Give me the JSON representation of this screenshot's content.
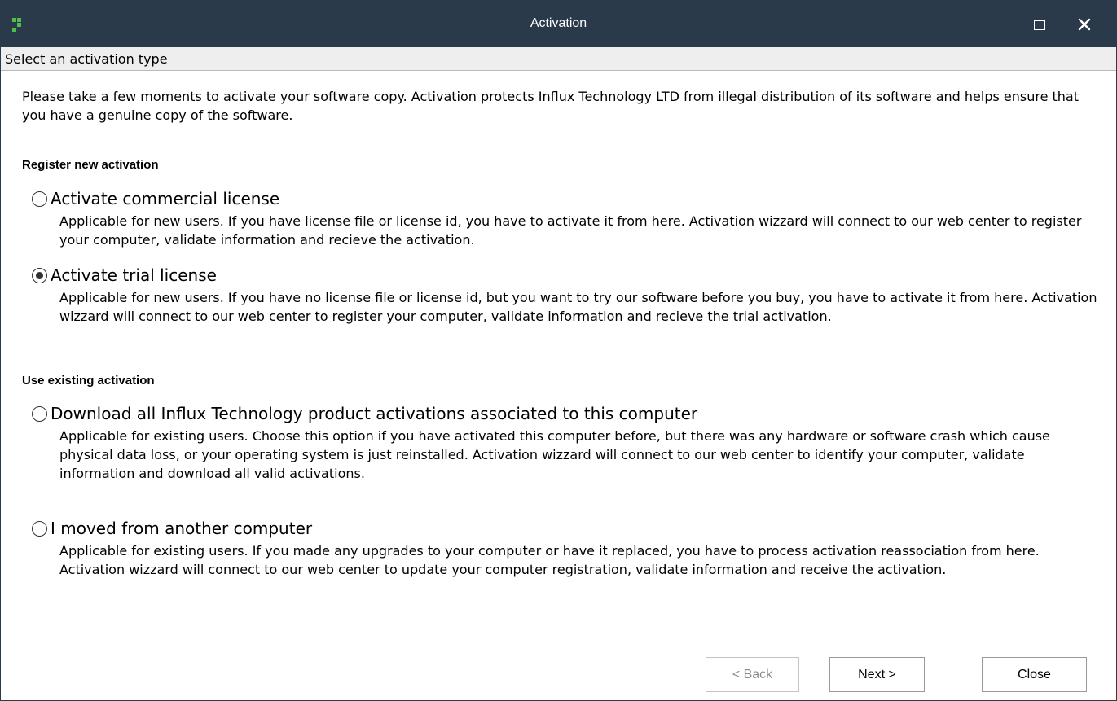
{
  "window": {
    "title": "Activation",
    "subheader": "Select an activation type"
  },
  "intro": "Please take a few moments to activate your software copy. Activation protects Influx Technology LTD from illegal distribution of its software and helps ensure that you have a genuine copy of the software.",
  "sections": [
    {
      "title": "Register new activation",
      "options": [
        {
          "label": "Activate commercial license",
          "description": "Applicable for new users. If you have license file or license id, you have to activate it from here. Activation wizzard will connect to our web center to register your computer, validate information and recieve the activation.",
          "selected": false
        },
        {
          "label": "Activate trial license",
          "description": "Applicable for new users. If you have no license file or license id, but you want to try our software before you buy, you have to activate it from here. Activation wizzard will connect to our web center to register your computer, validate information and recieve the trial activation.",
          "selected": true
        }
      ]
    },
    {
      "title": "Use existing activation",
      "options": [
        {
          "label": "Download all Influx Technology product activations associated to this computer",
          "description": "Applicable for existing users. Choose this option if you have activated this computer before, but there was any hardware or software crash which cause physical data loss, or your operating system is just reinstalled. Activation wizzard will connect to our web center to identify your computer, validate information and download all valid activations.",
          "selected": false
        },
        {
          "label": "I moved from another computer",
          "description": "Applicable for existing users. If you made any upgrades to your computer or have it replaced, you have to process activation reassociation from here. Activation wizzard will connect to our web center to update your computer registration, validate information and receive the activation.",
          "selected": false
        }
      ]
    }
  ],
  "buttons": {
    "back": "< Back",
    "next": "Next >",
    "close": "Close"
  },
  "colors": {
    "titlebar": "#2b3a4a",
    "logo": "#4ec04a"
  },
  "icons": {
    "app": "app-logo-icon",
    "maximize": "maximize-icon",
    "close": "close-icon"
  }
}
